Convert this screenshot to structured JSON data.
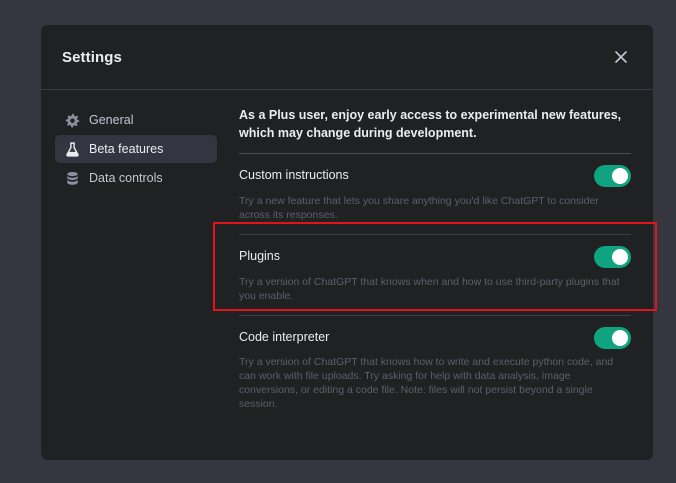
{
  "modal": {
    "title": "Settings",
    "close_icon": "close-icon"
  },
  "sidebar": {
    "items": [
      {
        "label": "General",
        "icon": "gear-icon",
        "active": false
      },
      {
        "label": "Beta features",
        "icon": "flask-icon",
        "active": true
      },
      {
        "label": "Data controls",
        "icon": "database-icon",
        "active": false
      }
    ]
  },
  "content": {
    "intro": "As a Plus user, enjoy early access to experimental new features, which may change during development.",
    "features": [
      {
        "title": "Custom instructions",
        "description": "Try a new feature that lets you share anything you'd like ChatGPT to consider across its responses.",
        "enabled": true
      },
      {
        "title": "Plugins",
        "description": "Try a version of ChatGPT that knows when and how to use third-party plugins that you enable.",
        "enabled": true
      },
      {
        "title": "Code interpreter",
        "description": "Try a version of ChatGPT that knows how to write and execute python code, and can work with file uploads. Try asking for help with data analysis, image conversions, or editing a code file. Note: files will not persist beyond a single session.",
        "enabled": true
      }
    ]
  },
  "colors": {
    "toggle_on": "#10a37f",
    "highlight": "#e0151c",
    "modal_bg": "#202123",
    "backdrop": "#353640"
  }
}
